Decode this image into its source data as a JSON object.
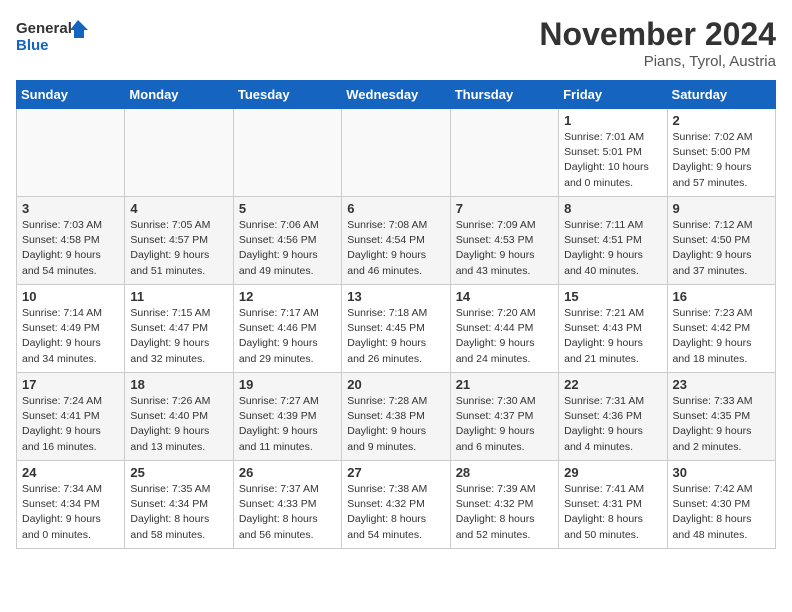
{
  "logo": {
    "line1": "General",
    "line2": "Blue"
  },
  "title": "November 2024",
  "location": "Pians, Tyrol, Austria",
  "weekdays": [
    "Sunday",
    "Monday",
    "Tuesday",
    "Wednesday",
    "Thursday",
    "Friday",
    "Saturday"
  ],
  "weeks": [
    [
      {
        "day": "",
        "info": ""
      },
      {
        "day": "",
        "info": ""
      },
      {
        "day": "",
        "info": ""
      },
      {
        "day": "",
        "info": ""
      },
      {
        "day": "",
        "info": ""
      },
      {
        "day": "1",
        "info": "Sunrise: 7:01 AM\nSunset: 5:01 PM\nDaylight: 10 hours\nand 0 minutes."
      },
      {
        "day": "2",
        "info": "Sunrise: 7:02 AM\nSunset: 5:00 PM\nDaylight: 9 hours\nand 57 minutes."
      }
    ],
    [
      {
        "day": "3",
        "info": "Sunrise: 7:03 AM\nSunset: 4:58 PM\nDaylight: 9 hours\nand 54 minutes."
      },
      {
        "day": "4",
        "info": "Sunrise: 7:05 AM\nSunset: 4:57 PM\nDaylight: 9 hours\nand 51 minutes."
      },
      {
        "day": "5",
        "info": "Sunrise: 7:06 AM\nSunset: 4:56 PM\nDaylight: 9 hours\nand 49 minutes."
      },
      {
        "day": "6",
        "info": "Sunrise: 7:08 AM\nSunset: 4:54 PM\nDaylight: 9 hours\nand 46 minutes."
      },
      {
        "day": "7",
        "info": "Sunrise: 7:09 AM\nSunset: 4:53 PM\nDaylight: 9 hours\nand 43 minutes."
      },
      {
        "day": "8",
        "info": "Sunrise: 7:11 AM\nSunset: 4:51 PM\nDaylight: 9 hours\nand 40 minutes."
      },
      {
        "day": "9",
        "info": "Sunrise: 7:12 AM\nSunset: 4:50 PM\nDaylight: 9 hours\nand 37 minutes."
      }
    ],
    [
      {
        "day": "10",
        "info": "Sunrise: 7:14 AM\nSunset: 4:49 PM\nDaylight: 9 hours\nand 34 minutes."
      },
      {
        "day": "11",
        "info": "Sunrise: 7:15 AM\nSunset: 4:47 PM\nDaylight: 9 hours\nand 32 minutes."
      },
      {
        "day": "12",
        "info": "Sunrise: 7:17 AM\nSunset: 4:46 PM\nDaylight: 9 hours\nand 29 minutes."
      },
      {
        "day": "13",
        "info": "Sunrise: 7:18 AM\nSunset: 4:45 PM\nDaylight: 9 hours\nand 26 minutes."
      },
      {
        "day": "14",
        "info": "Sunrise: 7:20 AM\nSunset: 4:44 PM\nDaylight: 9 hours\nand 24 minutes."
      },
      {
        "day": "15",
        "info": "Sunrise: 7:21 AM\nSunset: 4:43 PM\nDaylight: 9 hours\nand 21 minutes."
      },
      {
        "day": "16",
        "info": "Sunrise: 7:23 AM\nSunset: 4:42 PM\nDaylight: 9 hours\nand 18 minutes."
      }
    ],
    [
      {
        "day": "17",
        "info": "Sunrise: 7:24 AM\nSunset: 4:41 PM\nDaylight: 9 hours\nand 16 minutes."
      },
      {
        "day": "18",
        "info": "Sunrise: 7:26 AM\nSunset: 4:40 PM\nDaylight: 9 hours\nand 13 minutes."
      },
      {
        "day": "19",
        "info": "Sunrise: 7:27 AM\nSunset: 4:39 PM\nDaylight: 9 hours\nand 11 minutes."
      },
      {
        "day": "20",
        "info": "Sunrise: 7:28 AM\nSunset: 4:38 PM\nDaylight: 9 hours\nand 9 minutes."
      },
      {
        "day": "21",
        "info": "Sunrise: 7:30 AM\nSunset: 4:37 PM\nDaylight: 9 hours\nand 6 minutes."
      },
      {
        "day": "22",
        "info": "Sunrise: 7:31 AM\nSunset: 4:36 PM\nDaylight: 9 hours\nand 4 minutes."
      },
      {
        "day": "23",
        "info": "Sunrise: 7:33 AM\nSunset: 4:35 PM\nDaylight: 9 hours\nand 2 minutes."
      }
    ],
    [
      {
        "day": "24",
        "info": "Sunrise: 7:34 AM\nSunset: 4:34 PM\nDaylight: 9 hours\nand 0 minutes."
      },
      {
        "day": "25",
        "info": "Sunrise: 7:35 AM\nSunset: 4:34 PM\nDaylight: 8 hours\nand 58 minutes."
      },
      {
        "day": "26",
        "info": "Sunrise: 7:37 AM\nSunset: 4:33 PM\nDaylight: 8 hours\nand 56 minutes."
      },
      {
        "day": "27",
        "info": "Sunrise: 7:38 AM\nSunset: 4:32 PM\nDaylight: 8 hours\nand 54 minutes."
      },
      {
        "day": "28",
        "info": "Sunrise: 7:39 AM\nSunset: 4:32 PM\nDaylight: 8 hours\nand 52 minutes."
      },
      {
        "day": "29",
        "info": "Sunrise: 7:41 AM\nSunset: 4:31 PM\nDaylight: 8 hours\nand 50 minutes."
      },
      {
        "day": "30",
        "info": "Sunrise: 7:42 AM\nSunset: 4:30 PM\nDaylight: 8 hours\nand 48 minutes."
      }
    ]
  ]
}
